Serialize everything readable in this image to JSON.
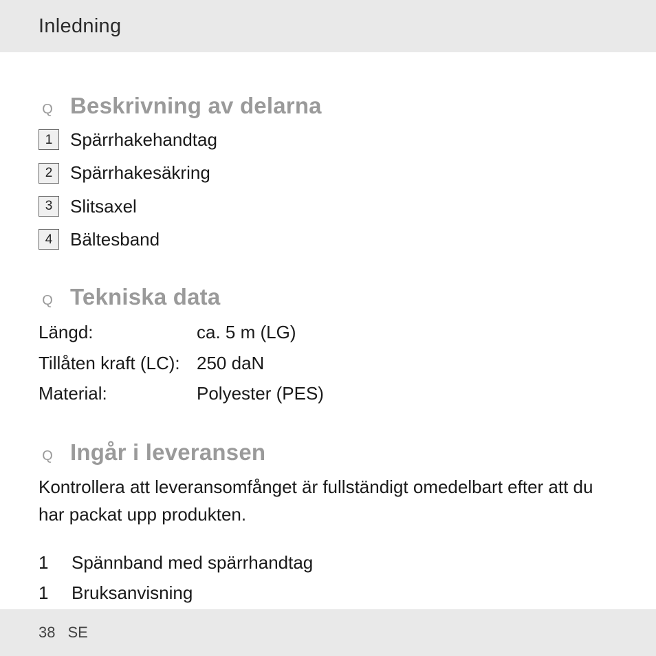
{
  "header": {
    "title": "Inledning"
  },
  "sections": {
    "parts": {
      "bullet": "Q",
      "title": "Beskrivning av delarna",
      "items": [
        {
          "n": "1",
          "label": "Spärrhakehandtag"
        },
        {
          "n": "2",
          "label": "Spärrhakesäkring"
        },
        {
          "n": "3",
          "label": "Slitsaxel"
        },
        {
          "n": "4",
          "label": "Bältesband"
        }
      ]
    },
    "tech": {
      "bullet": "Q",
      "title": "Tekniska data",
      "rows": [
        {
          "label": "Längd:",
          "value": "ca. 5 m (LG)"
        },
        {
          "label": "Tillåten kraft (LC):",
          "value": "250 daN"
        },
        {
          "label": "Material:",
          "value": "Polyester (PES)"
        }
      ]
    },
    "contents": {
      "bullet": "Q",
      "title": "Ingår i leveransen",
      "paragraph": "Kontrollera att leveransomfånget är fullständigt omedelbart efter att du har packat upp produkten.",
      "items": [
        {
          "qty": "1",
          "name": "Spännband med spärrhandtag"
        },
        {
          "qty": "1",
          "name": "Bruksanvisning"
        }
      ]
    }
  },
  "footer": {
    "page": "38",
    "lang": "SE"
  }
}
